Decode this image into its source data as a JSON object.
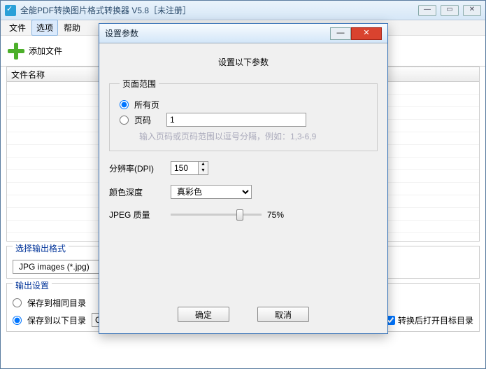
{
  "mainWindow": {
    "title": "全能PDF转换图片格式转换器 V5.8［未注册］",
    "menu": {
      "file": "文件",
      "options": "选项",
      "help": "帮助"
    },
    "toolbar": {
      "addFile": "添加文件"
    },
    "fileList": {
      "header": "文件名称"
    },
    "outputFormat": {
      "title": "选择输出格式",
      "value": "JPG images (*.jpg)"
    },
    "outputSettings": {
      "title": "输出设置",
      "saveSameDir": "保存到相同目录",
      "saveToDir": "保存到以下目录",
      "path": "C:\\Output",
      "openAfter": "转换后打开目标目录"
    }
  },
  "dialog": {
    "title": "设置参数",
    "subtitle": "设置以下参数",
    "pageRange": {
      "legend": "页面范围",
      "all": "所有页",
      "pages": "页码",
      "pagesValue": "1",
      "hint": "输入页码或页码范围以逗号分隔，例如：1,3-6,9"
    },
    "dpi": {
      "label": "分辨率(DPI)",
      "value": "150"
    },
    "colorDepth": {
      "label": "颜色深度",
      "value": "真彩色"
    },
    "jpeg": {
      "label": "JPEG 质量",
      "percent": "75%"
    },
    "buttons": {
      "ok": "确定",
      "cancel": "取消"
    }
  }
}
